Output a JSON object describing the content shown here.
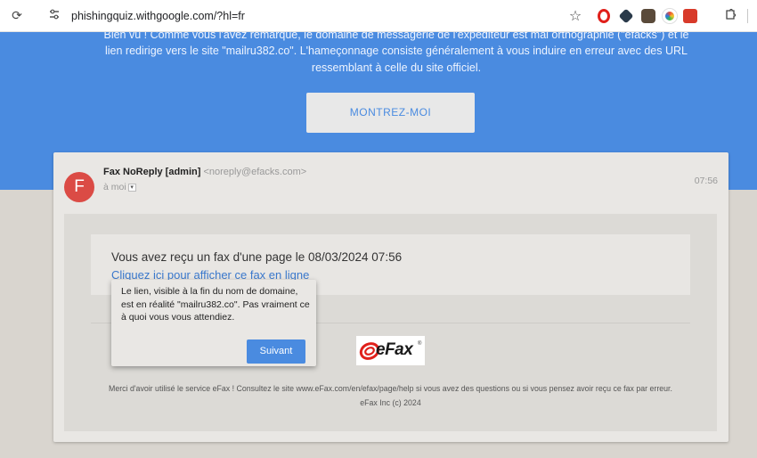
{
  "browser": {
    "url": "phishingquiz.withgoogle.com/?hl=fr",
    "reload_icon": "reload-icon",
    "site_settings_icon": "site-settings-icon",
    "bookmark_icon": "star-icon",
    "extension_icons": [
      "opera-icon",
      "hexagon-icon",
      "spy-icon",
      "colorful-circle-icon",
      "red-square-icon",
      "puzzle-icon"
    ]
  },
  "banner": {
    "explanation_lines": [
      "Bien vu ! Comme vous l'avez remarqué, le domaine de messagerie de l'expéditeur est mal orthographié (\"efacks\") et le",
      "lien redirige vers le site \"mailru382.co\". L'hameçonnage consiste généralement à vous induire en erreur avec des URL",
      "ressemblant à celle du site officiel."
    ],
    "show_me_label": "MONTREZ-MOI"
  },
  "email": {
    "avatar_letter": "F",
    "sender_name": "Fax NoReply [admin]",
    "sender_email": "<noreply@efacks.com>",
    "recipient": "à moi",
    "time": "07:56",
    "fax_message": "Vous avez reçu un fax d'une page le 08/03/2024 07:56",
    "fax_link": "Cliquez ici pour afficher ce fax en ligne",
    "logo_text": "eFax",
    "footer_line1": "Merci d'avoir utilisé le service eFax ! Consultez le site www.eFax.com/en/efax/page/help si vous avez des questions ou si vous pensez avoir reçu ce fax par erreur.",
    "footer_line2": "eFax Inc (c) 2024"
  },
  "tooltip": {
    "text": "Le lien, visible à la fin du nom de domaine, est en réalité \"mailru382.co\". Pas vraiment ce à quoi vous vous attendiez.",
    "next_label": "Suivant"
  },
  "colors": {
    "banner_blue": "#4a8be0",
    "avatar_red": "#db4b45",
    "link_blue": "#3a78cc"
  }
}
